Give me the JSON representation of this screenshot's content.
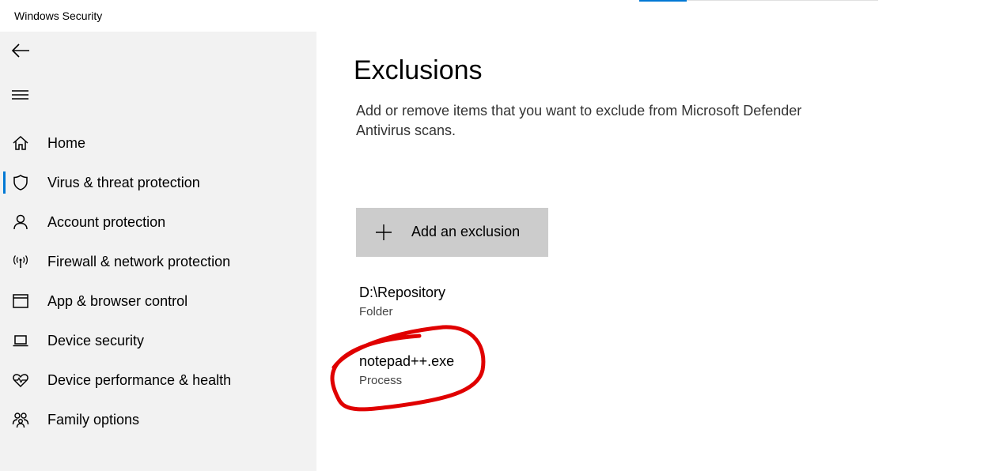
{
  "window": {
    "title": "Windows Security"
  },
  "sidebar": {
    "back_icon": "back-arrow-icon",
    "menu_icon": "hamburger-menu-icon",
    "accent_color": "#0078d4",
    "items": [
      {
        "label": "Home",
        "icon": "home-icon",
        "active": false
      },
      {
        "label": "Virus & threat protection",
        "icon": "shield-icon",
        "active": true
      },
      {
        "label": "Account protection",
        "icon": "person-icon",
        "active": false
      },
      {
        "label": "Firewall & network protection",
        "icon": "antenna-icon",
        "active": false
      },
      {
        "label": "App & browser control",
        "icon": "browser-window-icon",
        "active": false
      },
      {
        "label": "Device security",
        "icon": "laptop-icon",
        "active": false
      },
      {
        "label": "Device performance & health",
        "icon": "heart-pulse-icon",
        "active": false
      },
      {
        "label": "Family options",
        "icon": "family-icon",
        "active": false
      }
    ]
  },
  "main": {
    "title": "Exclusions",
    "description": "Add or remove items that you want to exclude from Microsoft Defender Antivirus scans.",
    "add_button": {
      "label": "Add an exclusion",
      "icon": "plus-icon"
    },
    "exclusions": [
      {
        "name": "D:\\Repository",
        "type": "Folder"
      },
      {
        "name": "notepad++.exe",
        "type": "Process",
        "highlighted": true
      }
    ]
  },
  "annotation": {
    "color": "#e00000"
  }
}
